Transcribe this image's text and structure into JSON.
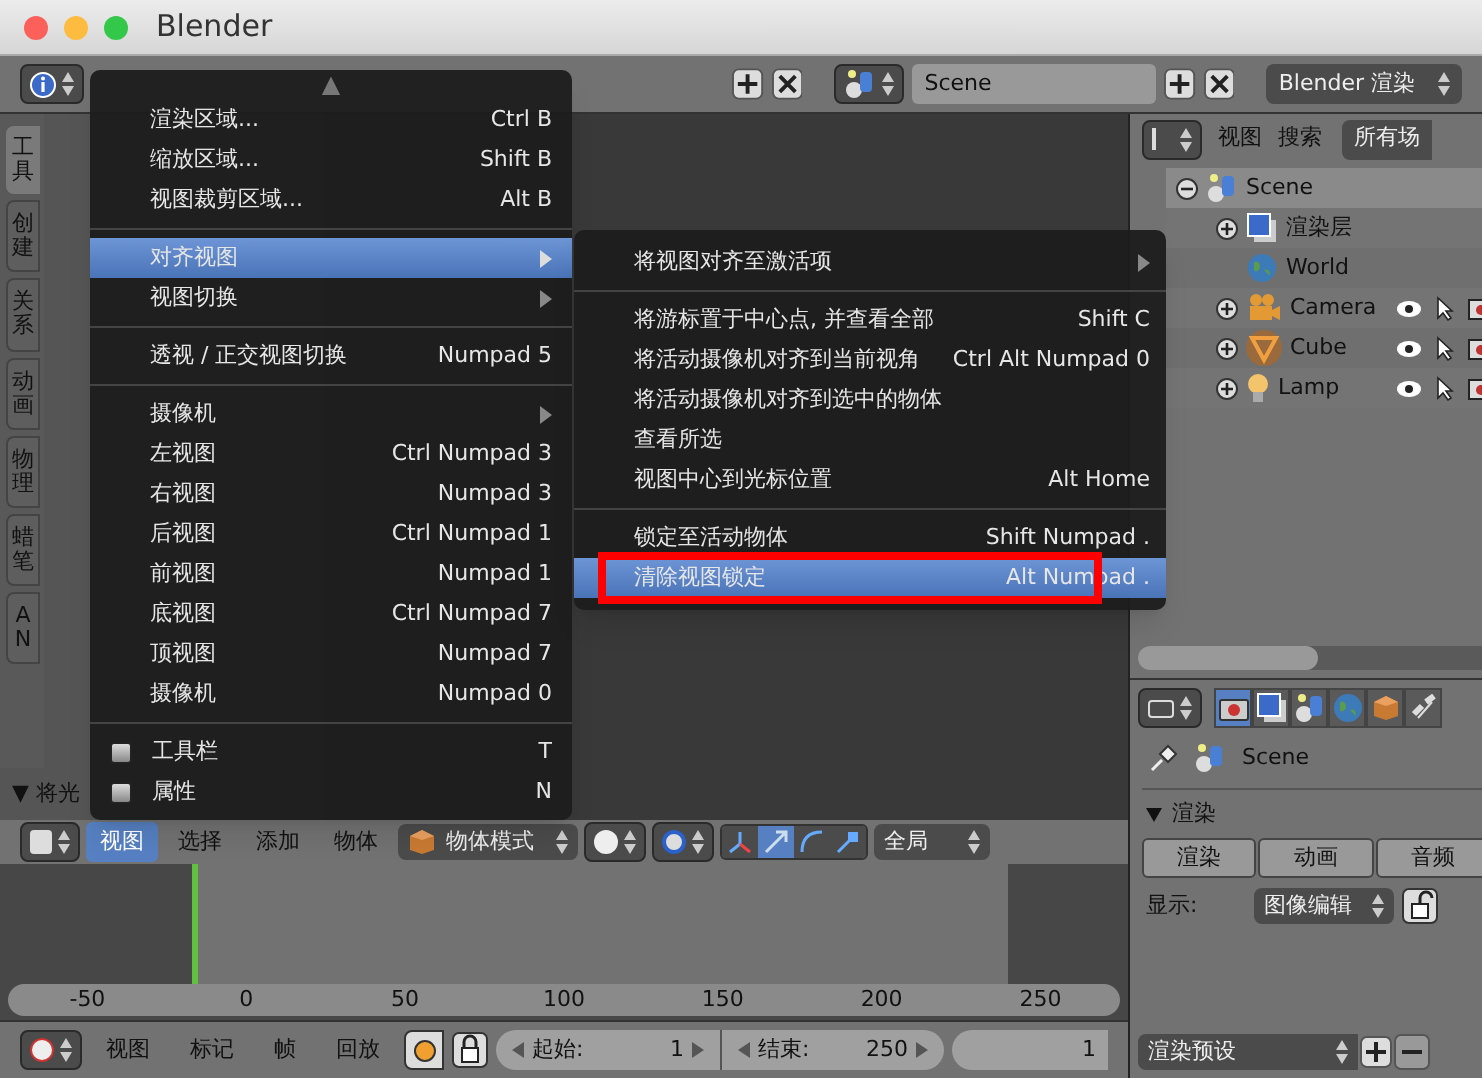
{
  "window": {
    "title": "Blender"
  },
  "top_header": {
    "scene": "Scene",
    "render_engine": "Blender 渲染"
  },
  "tool_shelf": {
    "tabs": [
      {
        "label": "工具",
        "selected": true
      },
      {
        "label": "创建",
        "selected": false
      },
      {
        "label": "关系",
        "selected": false
      },
      {
        "label": "动画",
        "selected": false
      },
      {
        "label": "物理",
        "selected": false
      },
      {
        "label": "蜡笔",
        "selected": false
      },
      {
        "label": "AN",
        "selected": false
      }
    ],
    "panel_label": "▼ 将光"
  },
  "view_menu": {
    "scroll_indicator": "▲",
    "items": [
      {
        "kind": "item",
        "label": "渲染区域...",
        "shortcut": "Ctrl B",
        "submenu": false,
        "selected": false
      },
      {
        "kind": "item",
        "label": "缩放区域...",
        "shortcut": "Shift B",
        "submenu": false,
        "selected": false
      },
      {
        "kind": "item",
        "label": "视图裁剪区域...",
        "shortcut": "Alt B",
        "submenu": false,
        "selected": false
      },
      {
        "kind": "separator"
      },
      {
        "kind": "item",
        "label": "对齐视图",
        "submenu": true,
        "selected": true
      },
      {
        "kind": "item",
        "label": "视图切换",
        "submenu": true,
        "selected": false
      },
      {
        "kind": "separator"
      },
      {
        "kind": "item",
        "label": "透视 / 正交视图切换",
        "shortcut": "Numpad 5",
        "submenu": false,
        "selected": false
      },
      {
        "kind": "separator"
      },
      {
        "kind": "item",
        "label": "摄像机",
        "submenu": true,
        "selected": false
      },
      {
        "kind": "item",
        "label": "左视图",
        "shortcut": "Ctrl Numpad 3",
        "submenu": false,
        "selected": false
      },
      {
        "kind": "item",
        "label": "右视图",
        "shortcut": "Numpad 3",
        "submenu": false,
        "selected": false
      },
      {
        "kind": "item",
        "label": "后视图",
        "shortcut": "Ctrl Numpad 1",
        "submenu": false,
        "selected": false
      },
      {
        "kind": "item",
        "label": "前视图",
        "shortcut": "Numpad 1",
        "submenu": false,
        "selected": false
      },
      {
        "kind": "item",
        "label": "底视图",
        "shortcut": "Ctrl Numpad 7",
        "submenu": false,
        "selected": false
      },
      {
        "kind": "item",
        "label": "顶视图",
        "shortcut": "Numpad 7",
        "submenu": false,
        "selected": false
      },
      {
        "kind": "item",
        "label": "摄像机",
        "shortcut": "Numpad 0",
        "submenu": false,
        "selected": false
      },
      {
        "kind": "separator"
      },
      {
        "kind": "checkbox",
        "label": "工具栏",
        "shortcut": "T",
        "checked": false
      },
      {
        "kind": "checkbox",
        "label": "属性",
        "shortcut": "N",
        "checked": false
      }
    ]
  },
  "align_submenu": {
    "items": [
      {
        "kind": "item",
        "label": "将视图对齐至激活项",
        "submenu": true,
        "selected": false
      },
      {
        "kind": "separator"
      },
      {
        "kind": "item",
        "label": "将游标置于中心点, 并查看全部",
        "shortcut": "Shift C",
        "submenu": false,
        "selected": false
      },
      {
        "kind": "item",
        "label": "将活动摄像机对齐到当前视角",
        "shortcut": "Ctrl Alt Numpad 0",
        "submenu": false,
        "selected": false
      },
      {
        "kind": "item",
        "label": "将活动摄像机对齐到选中的物体",
        "submenu": false,
        "selected": false
      },
      {
        "kind": "item",
        "label": "查看所选",
        "submenu": false,
        "selected": false
      },
      {
        "kind": "item",
        "label": "视图中心到光标位置",
        "shortcut": "Alt Home",
        "submenu": false,
        "selected": false
      },
      {
        "kind": "separator"
      },
      {
        "kind": "item",
        "label": "锁定至活动物体",
        "shortcut": "Shift Numpad .",
        "submenu": false,
        "selected": false
      },
      {
        "kind": "item",
        "label": "清除视图锁定",
        "shortcut": "Alt Numpad .",
        "submenu": false,
        "selected": true
      }
    ]
  },
  "outliner": {
    "menus": [
      "视图",
      "搜索"
    ],
    "filter": "所有场",
    "tree": [
      {
        "label": "Scene",
        "kind": "scene",
        "expanded": true,
        "selected": true,
        "children": [
          {
            "label": "渲染层",
            "kind": "render_layers",
            "expanded": false,
            "selected": false
          },
          {
            "label": "World",
            "kind": "world",
            "selected": false
          },
          {
            "label": "Camera",
            "kind": "camera",
            "expanded": false,
            "selected": false
          },
          {
            "label": "Cube",
            "kind": "mesh",
            "expanded": false,
            "selected": false
          },
          {
            "label": "Lamp",
            "kind": "lamp",
            "expanded": false,
            "selected": false
          }
        ]
      }
    ]
  },
  "properties": {
    "tabs": [
      {
        "kind": "render",
        "selected": true
      },
      {
        "kind": "render_layers",
        "selected": false
      },
      {
        "kind": "scene",
        "selected": false
      },
      {
        "kind": "world",
        "selected": false
      },
      {
        "kind": "object",
        "selected": false
      },
      {
        "kind": "constraints",
        "selected": false
      }
    ],
    "context": "Scene",
    "panel": {
      "title": "渲染",
      "expanded": true
    },
    "buttons": [
      "渲染",
      "动画",
      "音频"
    ],
    "display_label": "显示:",
    "display_value": "图像编辑",
    "preset": "渲染预设"
  },
  "viewport_header": {
    "menus": [
      {
        "label": "视图",
        "selected": true
      },
      {
        "label": "选择",
        "selected": false
      },
      {
        "label": "添加",
        "selected": false
      },
      {
        "label": "物体",
        "selected": false
      }
    ],
    "mode": "物体模式",
    "orientation": "全局"
  },
  "timeline": {
    "ticks": [
      "-50",
      "0",
      "50",
      "100",
      "150",
      "200",
      "250"
    ]
  },
  "timeline_header": {
    "menus": [
      "视图",
      "标记",
      "帧",
      "回放"
    ],
    "start_label": "起始:",
    "start": "1",
    "end_label": "结束:",
    "end": "250",
    "current": "1"
  }
}
